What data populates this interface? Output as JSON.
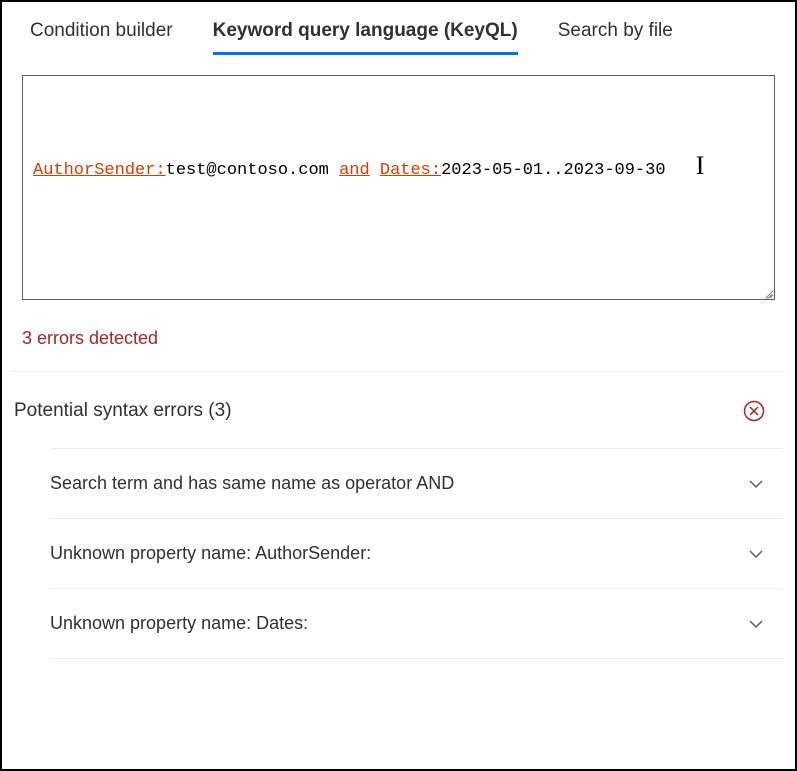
{
  "tabs": {
    "condition_builder": "Condition builder",
    "keyql": "Keyword query language (KeyQL)",
    "search_by_file": "Search by file"
  },
  "query": {
    "token1": "AuthorSender:",
    "token2": "test@contoso.com ",
    "token3": "and",
    "token4": " ",
    "token5": "Dates:",
    "token6": "2023-05-01..2023-09-30"
  },
  "error_summary": "3 errors detected",
  "section": {
    "title": "Potential syntax errors (3)"
  },
  "errors": [
    {
      "text": "Search term and has same name as operator AND"
    },
    {
      "text": "Unknown property name: AuthorSender:"
    },
    {
      "text": "Unknown property name: Dates:"
    }
  ]
}
